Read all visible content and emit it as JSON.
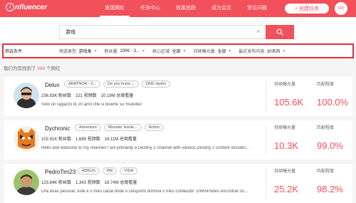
{
  "header": {
    "logo": "nfluencer",
    "nav": [
      "发现网红",
      "任务中心",
      "效果追踪",
      "成为会员",
      "常见问题"
    ],
    "create_task": "+ 创建任务",
    "avatar_initials": "GE"
  },
  "search": {
    "value": "游戏",
    "clear_icon": "×"
  },
  "filters": {
    "title": "筛选条件:",
    "items": [
      {
        "label": "频道类型:",
        "value": "游戏类"
      },
      {
        "label": "粉丝量:",
        "value": "100K - 3..."
      },
      {
        "label": "核心区域:",
        "value": "全部"
      },
      {
        "label": "持续曝光量:",
        "value": "全部"
      },
      {
        "label": "最近发布内容:",
        "value": "30天内"
      }
    ]
  },
  "results": {
    "prefix": "我们为您找到了 ",
    "count": "243",
    "suffix": " 个网红"
  },
  "metric_labels": {
    "exposure": "持续曝光量",
    "match": "匹配程度"
  },
  "cards": [
    {
      "name": "Delux",
      "tags": [
        "ARATNON - 2...",
        "Do you know ...",
        "DNS studio"
      ],
      "fans": "236.83K 粉丝数",
      "videos": "221 视频数",
      "views": "10.19M 总观看量",
      "desc": "Solo un ragazzo di 20 anni che si diverte su Youtube!",
      "exposure": "105.6K",
      "match": "100.0%"
    },
    {
      "name": "Dychronic",
      "tags": [
        "Adventure",
        "Monster Hunte...",
        "Action"
      ],
      "fans": "102.91K 粉丝数",
      "videos": "1,689 视频数",
      "views": "18.11M 总观看量",
      "desc": "Hello and welcome to my channel! I am primarily a Destiny 2 channel with various Destiny 2 content includin...",
      "exposure": "10.3K",
      "match": "99.0%"
    },
    {
      "name": "PedroTim23",
      "tags": [
        "ADEUS",
        "PAI",
        "VIDA"
      ],
      "fans": "123.84K 粉丝数",
      "videos": "1,343 视频数",
      "views": "18.74M 总观看量",
      "desc": "Ora boas pessoal, este é o meu canal onde o Desporto domina o meu conteúdo! :DWinPodes encontrar os...",
      "exposure": "25.2K",
      "match": "98.2%"
    }
  ]
}
